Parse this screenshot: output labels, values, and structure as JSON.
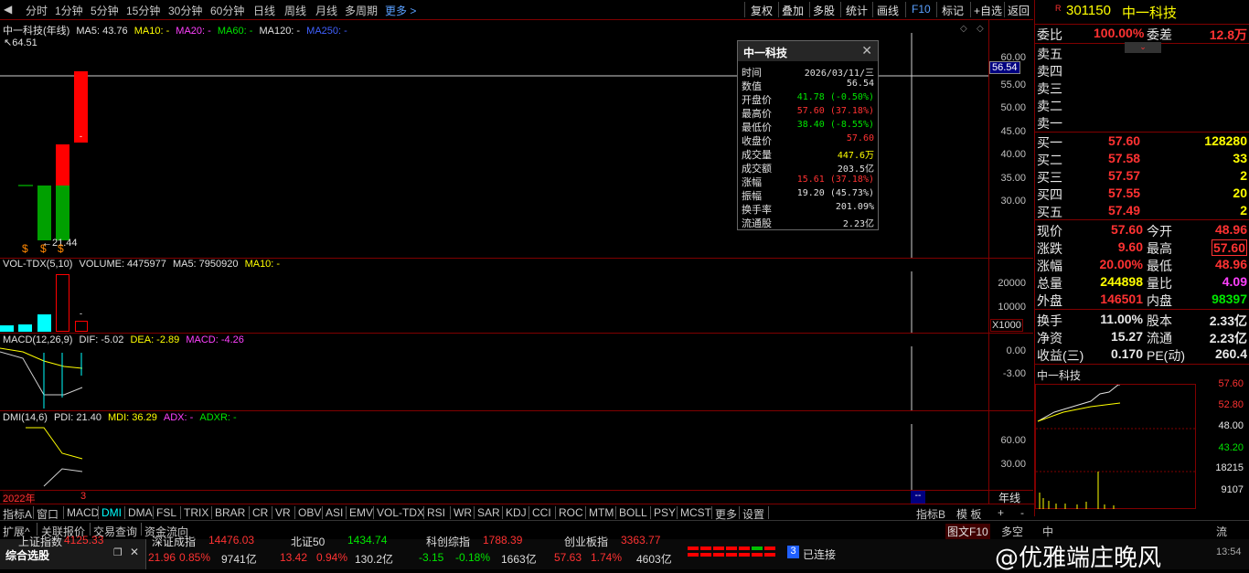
{
  "topbar": {
    "periods": [
      "分时",
      "1分钟",
      "5分钟",
      "15分钟",
      "30分钟",
      "60分钟",
      "日线",
      "周线",
      "月线",
      "多周期"
    ],
    "active": "年线",
    "more": "更多 >",
    "tools": [
      "复权",
      "叠加",
      "多股",
      "统计",
      "画线",
      "F10",
      "标记",
      "+自选",
      "返回"
    ]
  },
  "kline": {
    "title": "中一科技(年线)",
    "ma5": "MA5: 43.76",
    "ma10": "MA10: -",
    "ma20": "MA20: -",
    "ma60": "MA60: -",
    "ma120": "MA120: -",
    "ma250": "MA250: -",
    "high_label": "64.51",
    "low_label": "21.44",
    "yticks": [
      "60.00",
      "55.00",
      "50.00",
      "45.00",
      "40.00",
      "35.00",
      "30.00"
    ],
    "cursor_price": "56.54",
    "candles": [
      {
        "open": 33,
        "close": 22,
        "high": 33,
        "low": 22,
        "color": "green"
      },
      {
        "open": 33,
        "close": 42,
        "high": 42,
        "low": 21.44,
        "color": "red",
        "green_part": {
          "from": 22,
          "to": 33
        }
      },
      {
        "open": 42,
        "close": 57.6,
        "high": 57.6,
        "low": 41.78,
        "color": "red"
      }
    ],
    "markers": [
      "$",
      "$",
      "$"
    ]
  },
  "volume": {
    "title": "VOL-TDX(5,10)",
    "value": "VOLUME: 4475977",
    "ma5": "MA5: 7950920",
    "ma10": "MA10: -",
    "yticks": [
      "20000",
      "10000"
    ],
    "unit": "X1000"
  },
  "macd": {
    "title": "MACD(12,26,9)",
    "dif": "DIF: -5.02",
    "dea": "DEA: -2.89",
    "macd": "MACD: -4.26",
    "yticks": [
      "0.00",
      "-3.00"
    ]
  },
  "dmi": {
    "title": "DMI(14,6)",
    "pdi": "PDI: 21.40",
    "mdi": "MDI: 36.29",
    "adx": "ADX: -",
    "adxr": "ADXR: -",
    "yticks": [
      "60.00",
      "30.00"
    ]
  },
  "xaxis": {
    "year": "2022年",
    "tick": "3"
  },
  "popup": {
    "title": "中一科技",
    "rows": [
      {
        "label": "时间",
        "value": "2026/03/11/三",
        "color": "white"
      },
      {
        "label": "数值",
        "value": "56.54",
        "color": "white"
      },
      {
        "label": "开盘价",
        "value": "41.78 (-0.50%)",
        "color": "green"
      },
      {
        "label": "最高价",
        "value": "57.60 (37.18%)",
        "color": "red"
      },
      {
        "label": "最低价",
        "value": "38.40 (-8.55%)",
        "color": "green"
      },
      {
        "label": "收盘价",
        "value": "57.60",
        "color": "red"
      },
      {
        "label": "成交量",
        "value": "447.6万",
        "color": "yellow"
      },
      {
        "label": "成交额",
        "value": "203.5亿",
        "color": "white"
      },
      {
        "label": "涨幅",
        "value": "15.61 (37.18%)",
        "color": "red"
      },
      {
        "label": "振幅",
        "value": "19.20 (45.73%)",
        "color": "white"
      },
      {
        "label": "换手率",
        "value": "201.09%",
        "color": "white"
      },
      {
        "label": "流通股",
        "value": "2.23亿",
        "color": "white"
      }
    ]
  },
  "stock": {
    "code": "301150",
    "name": "中一科技",
    "weibi_label": "委比",
    "weibi": "100.00%",
    "weicha_label": "委差",
    "weicha": "12.8万",
    "sells": [
      "卖五",
      "卖四",
      "卖三",
      "卖二",
      "卖一"
    ],
    "buys": [
      {
        "label": "买一",
        "price": "57.60",
        "vol": "128280"
      },
      {
        "label": "买二",
        "price": "57.58",
        "vol": "33"
      },
      {
        "label": "买三",
        "price": "57.57",
        "vol": "2"
      },
      {
        "label": "买四",
        "price": "57.55",
        "vol": "20"
      },
      {
        "label": "买五",
        "price": "57.49",
        "vol": "2"
      }
    ],
    "quote": [
      {
        "l1": "现价",
        "v1": "57.60",
        "c1": "red",
        "l2": "今开",
        "v2": "48.96",
        "c2": "red"
      },
      {
        "l1": "涨跌",
        "v1": "9.60",
        "c1": "red",
        "l2": "最高",
        "v2": "57.60",
        "c2": "red"
      },
      {
        "l1": "涨幅",
        "v1": "20.00%",
        "c1": "red",
        "l2": "最低",
        "v2": "48.96",
        "c2": "red"
      },
      {
        "l1": "总量",
        "v1": "244898",
        "c1": "yellow",
        "l2": "量比",
        "v2": "4.09",
        "c2": "magenta"
      },
      {
        "l1": "外盘",
        "v1": "146501",
        "c1": "red",
        "l2": "内盘",
        "v2": "98397",
        "c2": "green"
      }
    ],
    "info": [
      {
        "l1": "换手",
        "v1": "11.00%",
        "l2": "股本",
        "v2": "2.33亿"
      },
      {
        "l1": "净资",
        "v1": "15.27",
        "l2": "流通",
        "v2": "2.23亿"
      },
      {
        "l1": "收益(三)",
        "v1": "0.170",
        "l2": "PE(动)",
        "v2": "260.4"
      }
    ],
    "mini_title": "中一科技",
    "mini_ticks": [
      "57.60",
      "52.80",
      "48.00",
      "43.20",
      "18215",
      "9107"
    ],
    "period_label": "年线"
  },
  "indicator_tabs": [
    "指标A",
    "窗口",
    "MACD",
    "DMI",
    "DMA",
    "FSL",
    "TRIX",
    "BRAR",
    "CR",
    "VR",
    "OBV",
    "ASI",
    "EMV",
    "VOL-TDX",
    "RSI",
    "WR",
    "SAR",
    "KDJ",
    "CCI",
    "ROC",
    "MTM",
    "BOLL",
    "PSY",
    "MCST",
    "更多",
    "设置"
  ],
  "indicator_right": [
    "指标B",
    "模 板",
    "+",
    "-"
  ],
  "bar2": [
    "扩展^",
    "关联报价",
    "交易查询",
    "资金流向"
  ],
  "bar2_right": [
    "图文F10",
    "多空",
    "中",
    "流"
  ],
  "status": {
    "left_title": "综合选股",
    "indices": [
      {
        "name": "上证指数",
        "value": "4125.33",
        "chg": "21.96",
        "pct": "0.85%",
        "amt": "9741亿",
        "color": "red"
      },
      {
        "name": "深证成指",
        "value": "14476.03",
        "chg": "13.42",
        "pct": "0.94%",
        "amt": "130.2亿",
        "color": "red"
      },
      {
        "name": "北证50",
        "value": "1434.74",
        "chg": "-3.15",
        "pct": "-0.18%",
        "amt": "1663亿",
        "color": "green"
      },
      {
        "name": "科创综指",
        "value": "1788.39",
        "chg": "57.63",
        "pct": "1.74%",
        "amt": "4603亿",
        "color": "red"
      },
      {
        "name": "创业板指",
        "value": "3363.77",
        "chg": "",
        "pct": "",
        "amt": "",
        "color": "red"
      }
    ],
    "conn": "已连接",
    "conn_num": "3",
    "watermark": "@优雅端庄晚风",
    "time": "13:54"
  }
}
